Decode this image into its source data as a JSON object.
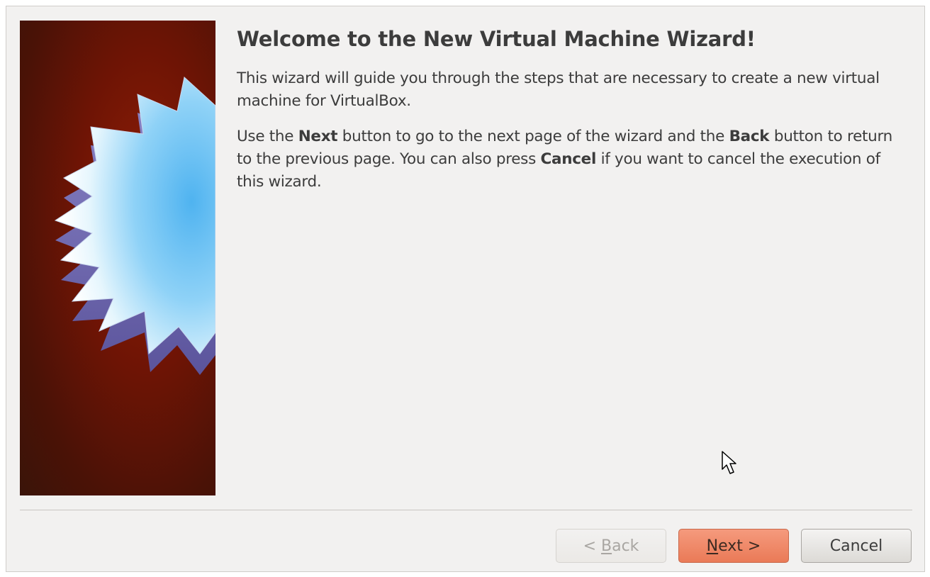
{
  "wizard": {
    "title": "Welcome to the New Virtual Machine Wizard!",
    "paragraph1": "This wizard will guide you through the steps that are necessary to create a new virtual machine for VirtualBox.",
    "paragraph2": {
      "t1": "Use the ",
      "next": "Next",
      "t2": " button to go to the next page of the wizard and the ",
      "back": "Back",
      "t3": " button to return to the previous page. You can also press ",
      "cancel": "Cancel",
      "t4": " if you want to cancel the execution of this wizard."
    }
  },
  "buttons": {
    "back": {
      "prefix": "< ",
      "mnemonic": "B",
      "rest": "ack",
      "enabled": false
    },
    "next": {
      "mnemonic": "N",
      "rest": "ext >",
      "enabled": true
    },
    "cancel": {
      "label": "Cancel",
      "enabled": true
    }
  },
  "colors": {
    "dialog_bg": "#f2f1f0",
    "banner_red": "#6e1405",
    "next_accent": "#ea7a57",
    "text": "#3c3c3c"
  }
}
